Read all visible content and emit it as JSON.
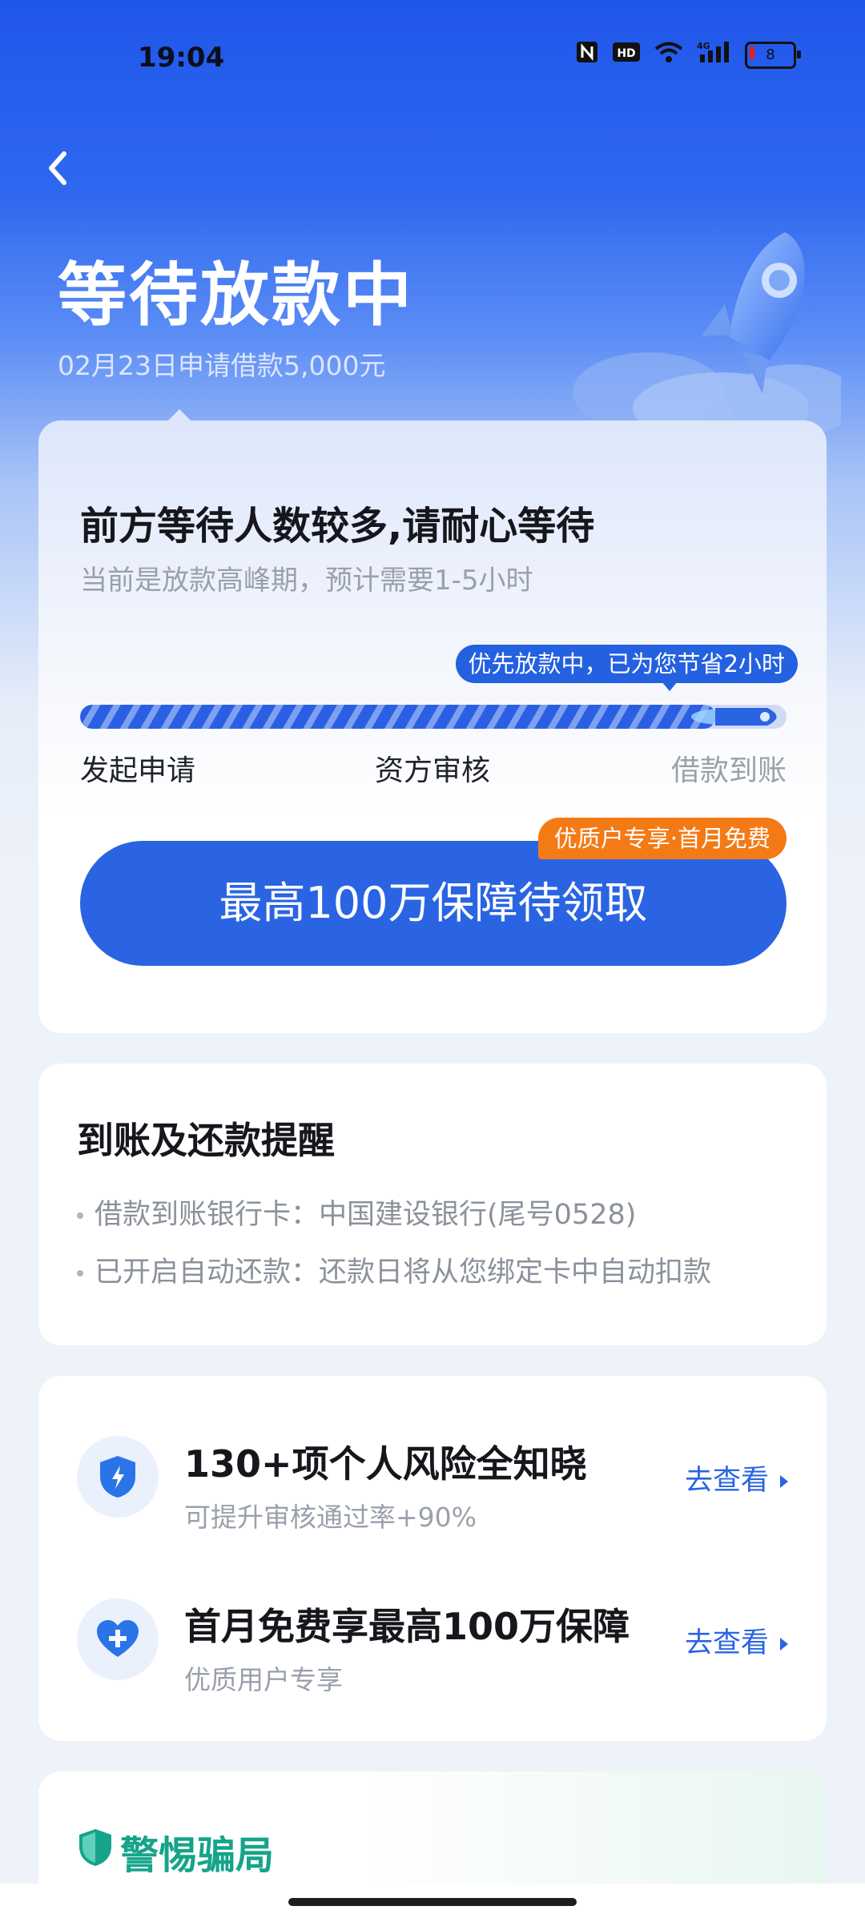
{
  "status_bar": {
    "time": "19:04",
    "icons": [
      "nfc-icon",
      "hd-icon",
      "wifi-icon",
      "4g-signal-icon",
      "battery-icon"
    ],
    "hd_label": "HD",
    "network_label": "4G",
    "battery_level": "8"
  },
  "header": {
    "title": "等待放款中",
    "subtitle": "02月23日申请借款5,000元"
  },
  "progress_card": {
    "heading": "前方等待人数较多,请耐心等待",
    "subheading": "当前是放款高峰期，预计需要1-5小时",
    "tip": "优先放款中，已为您节省2小时",
    "progress_fraction": 0.9,
    "steps": [
      "发起申请",
      "资方审核",
      "借款到账"
    ],
    "cta_label": "最高100万保障待领取",
    "cta_badge": "优质户专享·首月免费"
  },
  "reminder_card": {
    "heading": "到账及还款提醒",
    "lines": [
      "借款到账银行卡：中国建设银行(尾号0528)",
      "已开启自动还款：还款日将从您绑定卡中自动扣款"
    ]
  },
  "offers_card": {
    "items": [
      {
        "icon": "shield-lightning-icon",
        "title": "130+项个人风险全知晓",
        "subtitle": "可提升审核通过率+90%",
        "action": "去查看"
      },
      {
        "icon": "heart-plus-icon",
        "title": "首月免费享最高100万保障",
        "subtitle": "优质用户专享",
        "action": "去查看"
      }
    ]
  },
  "fraud_card": {
    "heading": "警惕骗局"
  },
  "colors": {
    "primary": "#2a64e3",
    "orange_badge": "#f47a16",
    "fraud_green": "#15a48a"
  }
}
